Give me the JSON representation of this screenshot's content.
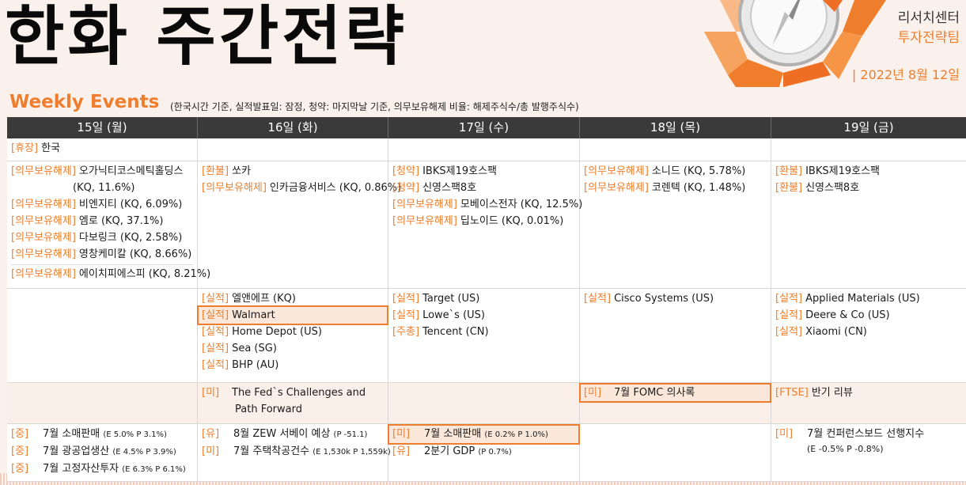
{
  "header": {
    "title": "한화 주간전략",
    "org_line1": "리서치센터",
    "org_line2": "투자전략팀",
    "date": "| 2022년 8월 12일"
  },
  "weekly": {
    "title": "Weekly Events",
    "note": "(한국시간 기준, 실적발표일: 잠정, 청약: 마지막날 기준, 의무보유해제 비율: 해제주식수/총 발행주식수)"
  },
  "days": [
    "15일 (월)",
    "16일 (화)",
    "17일 (수)",
    "18일 (목)",
    "19일 (금)"
  ],
  "colors": {
    "accent": "#ee7e2d",
    "header_bg": "#3a3a3a"
  },
  "row1": {
    "mon": {
      "tag": "[휴장]",
      "text": "한국"
    }
  },
  "row2": {
    "mon": [
      {
        "tag": "[의무보유해제]",
        "text": "오가닉티코스메틱홀딩스"
      },
      {
        "tag": "",
        "text": "(KQ, 11.6%)"
      },
      {
        "tag": "[의무보유해제]",
        "text": "비엔지티 (KQ, 6.09%)"
      },
      {
        "tag": "[의무보유해제]",
        "text": "엠로 (KQ, 37.1%)"
      },
      {
        "tag": "[의무보유해제]",
        "text": "다보링크 (KQ, 2.58%)"
      },
      {
        "tag": "[의무보유해제]",
        "text": "영창케미칼 (KQ, 8.66%)"
      },
      {
        "tag": "[의무보유해제]",
        "text": "에이치피에스피 (KQ, 8.21%)"
      }
    ],
    "tue": [
      {
        "tag": "[환불]",
        "text": "쏘카"
      },
      {
        "tag": "[의무보유해제]",
        "text": "인카금융서비스 (KQ, 0.86%)"
      }
    ],
    "wed": [
      {
        "tag": "[청약]",
        "text": "IBKS제19호스팩"
      },
      {
        "tag": "[청약]",
        "text": "신영스팩8호"
      },
      {
        "tag": "[의무보유해제]",
        "text": "모베이스전자 (KQ, 12.5%)"
      },
      {
        "tag": "[의무보유해제]",
        "text": "딥노이드 (KQ, 0.01%)"
      }
    ],
    "thu": [
      {
        "tag": "[의무보유해제]",
        "text": "소니드 (KQ, 5.78%)"
      },
      {
        "tag": "[의무보유해제]",
        "text": "코렌텍 (KQ, 1.48%)"
      }
    ],
    "fri": [
      {
        "tag": "[환불]",
        "text": "IBKS제19호스팩"
      },
      {
        "tag": "[환불]",
        "text": "신영스팩8호"
      }
    ]
  },
  "row3": {
    "tue": [
      {
        "tag": "[실적]",
        "text": "엘앤에프 (KQ)"
      },
      {
        "tag": "[실적]",
        "text": "Walmart"
      },
      {
        "tag": "[실적]",
        "text": "Home Depot (US)"
      },
      {
        "tag": "[실적]",
        "text": "Sea (SG)"
      },
      {
        "tag": "[실적]",
        "text": "BHP (AU)"
      }
    ],
    "wed": [
      {
        "tag": "[실적]",
        "text": "Target (US)"
      },
      {
        "tag": "[실적]",
        "text": "Lowe`s (US)"
      },
      {
        "tag": "[주총]",
        "text": "Tencent (CN)"
      }
    ],
    "thu": [
      {
        "tag": "[실적]",
        "text": "Cisco Systems (US)"
      }
    ],
    "fri": [
      {
        "tag": "[실적]",
        "text": "Applied Materials (US)"
      },
      {
        "tag": "[실적]",
        "text": "Deere & Co (US)"
      },
      {
        "tag": "[실적]",
        "text": "Xiaomi (CN)"
      }
    ]
  },
  "row4": {
    "tue": {
      "tag": "[미]",
      "line1": "The Fed`s Challenges and",
      "line2": "Path Forward"
    },
    "thu": {
      "tag": "[미]",
      "text": "7월 FOMC 의사록"
    },
    "fri": {
      "tag": "[FTSE]",
      "text": "반기 리뷰"
    }
  },
  "row5": {
    "mon": [
      {
        "tag": "[중]",
        "text": "7월 소매판매",
        "detail": "(E 5.0% P 3.1%)"
      },
      {
        "tag": "[중]",
        "text": "7월 광공업생산",
        "detail": "(E 4.5% P 3.9%)"
      },
      {
        "tag": "[중]",
        "text": "7월 고정자산투자",
        "detail": "(E 6.3% P 6.1%)"
      }
    ],
    "tue": [
      {
        "tag": "[유]",
        "text": "8월 ZEW 서베이 예상",
        "detail": "(P -51.1)"
      },
      {
        "tag": "[미]",
        "text": "7월 주택착공건수",
        "detail": "(E 1,530k P 1,559k)"
      }
    ],
    "wed": [
      {
        "tag": "[미]",
        "text": "7월 소매판매",
        "detail": "(E 0.2% P 1.0%)"
      },
      {
        "tag": "[유]",
        "text": "2분기 GDP",
        "detail": "(P 0.7%)"
      }
    ],
    "fri": {
      "tag": "[미]",
      "text": "7월 컨퍼런스보드 선행지수",
      "detail": "(E -0.5% P -0.8%)"
    }
  }
}
